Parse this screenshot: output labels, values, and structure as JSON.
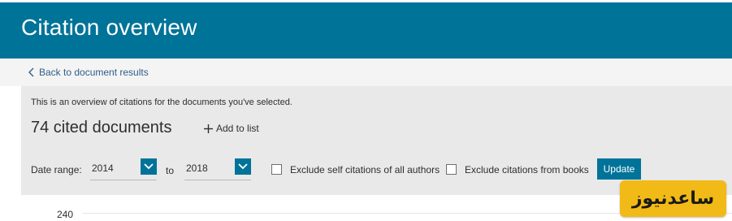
{
  "header": {
    "title": "Citation overview"
  },
  "nav": {
    "back_label": "Back to document results"
  },
  "overview": {
    "intro": "This is an overview of citations for the documents you've selected.",
    "cited_count": "74 cited documents",
    "add_to_list": "Add to list"
  },
  "filters": {
    "date_range_label": "Date range:",
    "from_year": "2014",
    "to_label": "to",
    "to_year": "2018",
    "exclude_self_label": "Exclude self citations of all authors",
    "exclude_books_label": "Exclude citations from books",
    "update_label": "Update"
  },
  "chart": {
    "y_tick_top": "240"
  },
  "watermark": {
    "text": "ساعدنیوز"
  },
  "colors": {
    "brand": "#007398",
    "panel": "#e9e9e9",
    "watermark_bg": "#f2ba16"
  }
}
